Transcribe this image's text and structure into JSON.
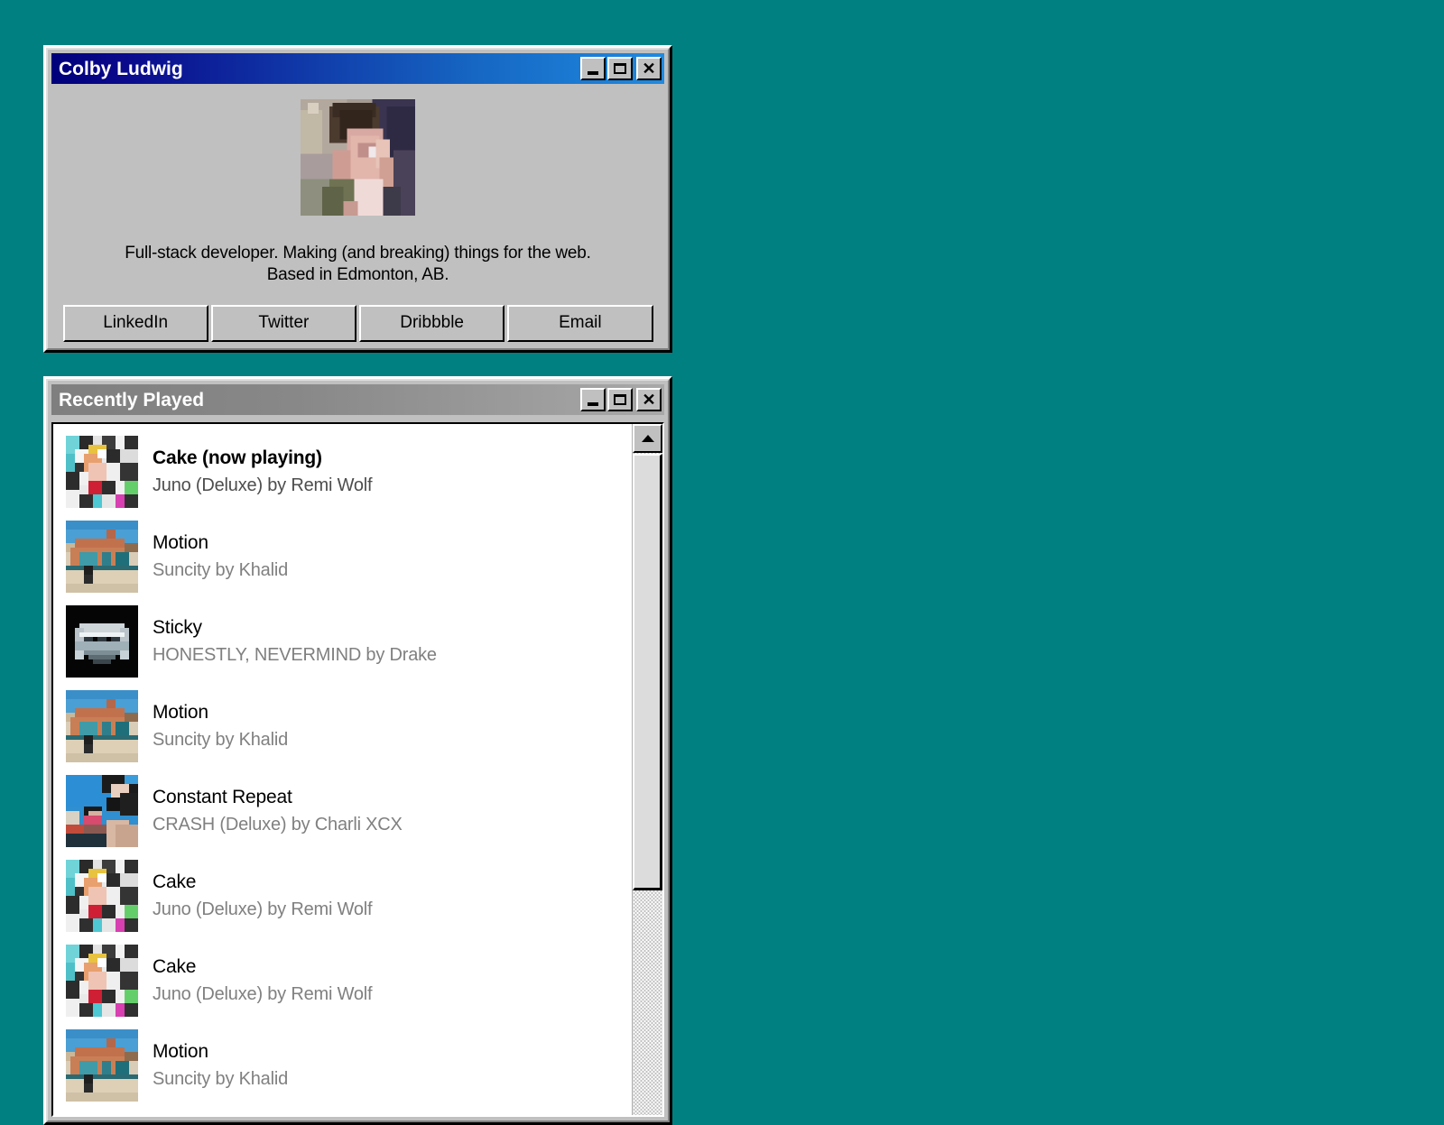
{
  "desktop": {
    "background_color": "#008080"
  },
  "profile_window": {
    "title": "Colby Ludwig",
    "state": "active",
    "controls": {
      "minimize": "minimize-icon",
      "maximize": "maximize-icon",
      "close": "close-icon",
      "close_glyph": "✕"
    },
    "avatar_alt": "portrait-photo",
    "bio": "Full-stack developer. Making (and breaking) things for the web.\nBased in Edmonton, AB.",
    "buttons": [
      {
        "label": "LinkedIn"
      },
      {
        "label": "Twitter"
      },
      {
        "label": "Dribbble"
      },
      {
        "label": "Email"
      }
    ]
  },
  "recent_window": {
    "title": "Recently Played",
    "state": "inactive",
    "controls": {
      "minimize": "minimize-icon",
      "maximize": "maximize-icon",
      "close": "close-icon",
      "close_glyph": "✕"
    },
    "scrollbar": {
      "up_arrow": "scroll-up-arrow",
      "thumb": "scroll-thumb"
    },
    "tracks": [
      {
        "title": "Cake (now playing)",
        "subtitle": "Juno (Deluxe) by Remi Wolf",
        "now_playing": true,
        "art": "juno"
      },
      {
        "title": "Motion",
        "subtitle": "Suncity by Khalid",
        "now_playing": false,
        "art": "suncity"
      },
      {
        "title": "Sticky",
        "subtitle": "HONESTLY, NEVERMIND by Drake",
        "now_playing": false,
        "art": "honestly"
      },
      {
        "title": "Motion",
        "subtitle": "Suncity by Khalid",
        "now_playing": false,
        "art": "suncity"
      },
      {
        "title": "Constant Repeat",
        "subtitle": "CRASH (Deluxe) by Charli XCX",
        "now_playing": false,
        "art": "crash"
      },
      {
        "title": "Cake",
        "subtitle": "Juno (Deluxe) by Remi Wolf",
        "now_playing": false,
        "art": "juno"
      },
      {
        "title": "Cake",
        "subtitle": "Juno (Deluxe) by Remi Wolf",
        "now_playing": false,
        "art": "juno"
      },
      {
        "title": "Motion",
        "subtitle": "Suncity by Khalid",
        "now_playing": false,
        "art": "suncity"
      }
    ]
  },
  "colors": {
    "desktop_teal": "#008080",
    "window_face": "#c0c0c0",
    "active_title_start": "#00007b",
    "active_title_end": "#1f8ae0",
    "inactive_title_start": "#7f7f7f",
    "inactive_title_end": "#a8a8a8",
    "list_background": "#ffffff",
    "subtitle_gray": "#808080"
  }
}
